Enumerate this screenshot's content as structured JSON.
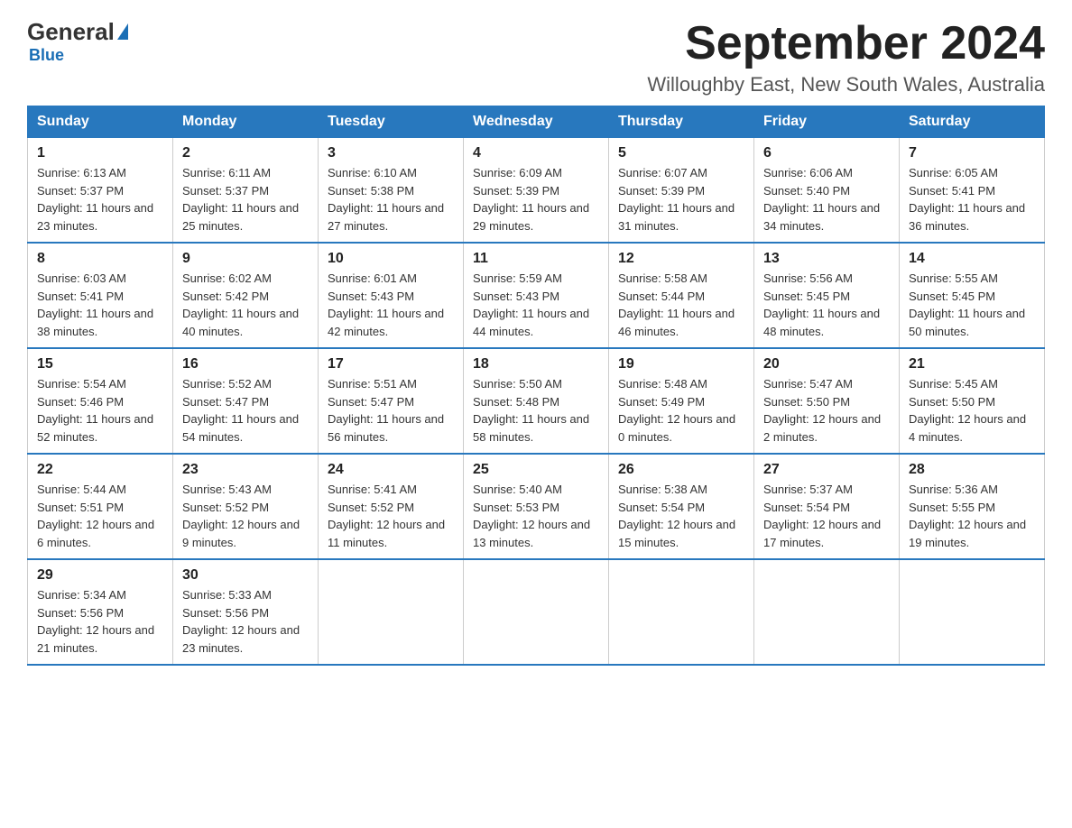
{
  "logo": {
    "general": "General",
    "blue": "Blue"
  },
  "header": {
    "month_title": "September 2024",
    "location": "Willoughby East, New South Wales, Australia"
  },
  "days_of_week": [
    "Sunday",
    "Monday",
    "Tuesday",
    "Wednesday",
    "Thursday",
    "Friday",
    "Saturday"
  ],
  "weeks": [
    [
      {
        "day": "1",
        "sunrise": "6:13 AM",
        "sunset": "5:37 PM",
        "daylight": "11 hours and 23 minutes."
      },
      {
        "day": "2",
        "sunrise": "6:11 AM",
        "sunset": "5:37 PM",
        "daylight": "11 hours and 25 minutes."
      },
      {
        "day": "3",
        "sunrise": "6:10 AM",
        "sunset": "5:38 PM",
        "daylight": "11 hours and 27 minutes."
      },
      {
        "day": "4",
        "sunrise": "6:09 AM",
        "sunset": "5:39 PM",
        "daylight": "11 hours and 29 minutes."
      },
      {
        "day": "5",
        "sunrise": "6:07 AM",
        "sunset": "5:39 PM",
        "daylight": "11 hours and 31 minutes."
      },
      {
        "day": "6",
        "sunrise": "6:06 AM",
        "sunset": "5:40 PM",
        "daylight": "11 hours and 34 minutes."
      },
      {
        "day": "7",
        "sunrise": "6:05 AM",
        "sunset": "5:41 PM",
        "daylight": "11 hours and 36 minutes."
      }
    ],
    [
      {
        "day": "8",
        "sunrise": "6:03 AM",
        "sunset": "5:41 PM",
        "daylight": "11 hours and 38 minutes."
      },
      {
        "day": "9",
        "sunrise": "6:02 AM",
        "sunset": "5:42 PM",
        "daylight": "11 hours and 40 minutes."
      },
      {
        "day": "10",
        "sunrise": "6:01 AM",
        "sunset": "5:43 PM",
        "daylight": "11 hours and 42 minutes."
      },
      {
        "day": "11",
        "sunrise": "5:59 AM",
        "sunset": "5:43 PM",
        "daylight": "11 hours and 44 minutes."
      },
      {
        "day": "12",
        "sunrise": "5:58 AM",
        "sunset": "5:44 PM",
        "daylight": "11 hours and 46 minutes."
      },
      {
        "day": "13",
        "sunrise": "5:56 AM",
        "sunset": "5:45 PM",
        "daylight": "11 hours and 48 minutes."
      },
      {
        "day": "14",
        "sunrise": "5:55 AM",
        "sunset": "5:45 PM",
        "daylight": "11 hours and 50 minutes."
      }
    ],
    [
      {
        "day": "15",
        "sunrise": "5:54 AM",
        "sunset": "5:46 PM",
        "daylight": "11 hours and 52 minutes."
      },
      {
        "day": "16",
        "sunrise": "5:52 AM",
        "sunset": "5:47 PM",
        "daylight": "11 hours and 54 minutes."
      },
      {
        "day": "17",
        "sunrise": "5:51 AM",
        "sunset": "5:47 PM",
        "daylight": "11 hours and 56 minutes."
      },
      {
        "day": "18",
        "sunrise": "5:50 AM",
        "sunset": "5:48 PM",
        "daylight": "11 hours and 58 minutes."
      },
      {
        "day": "19",
        "sunrise": "5:48 AM",
        "sunset": "5:49 PM",
        "daylight": "12 hours and 0 minutes."
      },
      {
        "day": "20",
        "sunrise": "5:47 AM",
        "sunset": "5:50 PM",
        "daylight": "12 hours and 2 minutes."
      },
      {
        "day": "21",
        "sunrise": "5:45 AM",
        "sunset": "5:50 PM",
        "daylight": "12 hours and 4 minutes."
      }
    ],
    [
      {
        "day": "22",
        "sunrise": "5:44 AM",
        "sunset": "5:51 PM",
        "daylight": "12 hours and 6 minutes."
      },
      {
        "day": "23",
        "sunrise": "5:43 AM",
        "sunset": "5:52 PM",
        "daylight": "12 hours and 9 minutes."
      },
      {
        "day": "24",
        "sunrise": "5:41 AM",
        "sunset": "5:52 PM",
        "daylight": "12 hours and 11 minutes."
      },
      {
        "day": "25",
        "sunrise": "5:40 AM",
        "sunset": "5:53 PM",
        "daylight": "12 hours and 13 minutes."
      },
      {
        "day": "26",
        "sunrise": "5:38 AM",
        "sunset": "5:54 PM",
        "daylight": "12 hours and 15 minutes."
      },
      {
        "day": "27",
        "sunrise": "5:37 AM",
        "sunset": "5:54 PM",
        "daylight": "12 hours and 17 minutes."
      },
      {
        "day": "28",
        "sunrise": "5:36 AM",
        "sunset": "5:55 PM",
        "daylight": "12 hours and 19 minutes."
      }
    ],
    [
      {
        "day": "29",
        "sunrise": "5:34 AM",
        "sunset": "5:56 PM",
        "daylight": "12 hours and 21 minutes."
      },
      {
        "day": "30",
        "sunrise": "5:33 AM",
        "sunset": "5:56 PM",
        "daylight": "12 hours and 23 minutes."
      },
      null,
      null,
      null,
      null,
      null
    ]
  ],
  "labels": {
    "sunrise": "Sunrise:",
    "sunset": "Sunset:",
    "daylight": "Daylight:"
  }
}
